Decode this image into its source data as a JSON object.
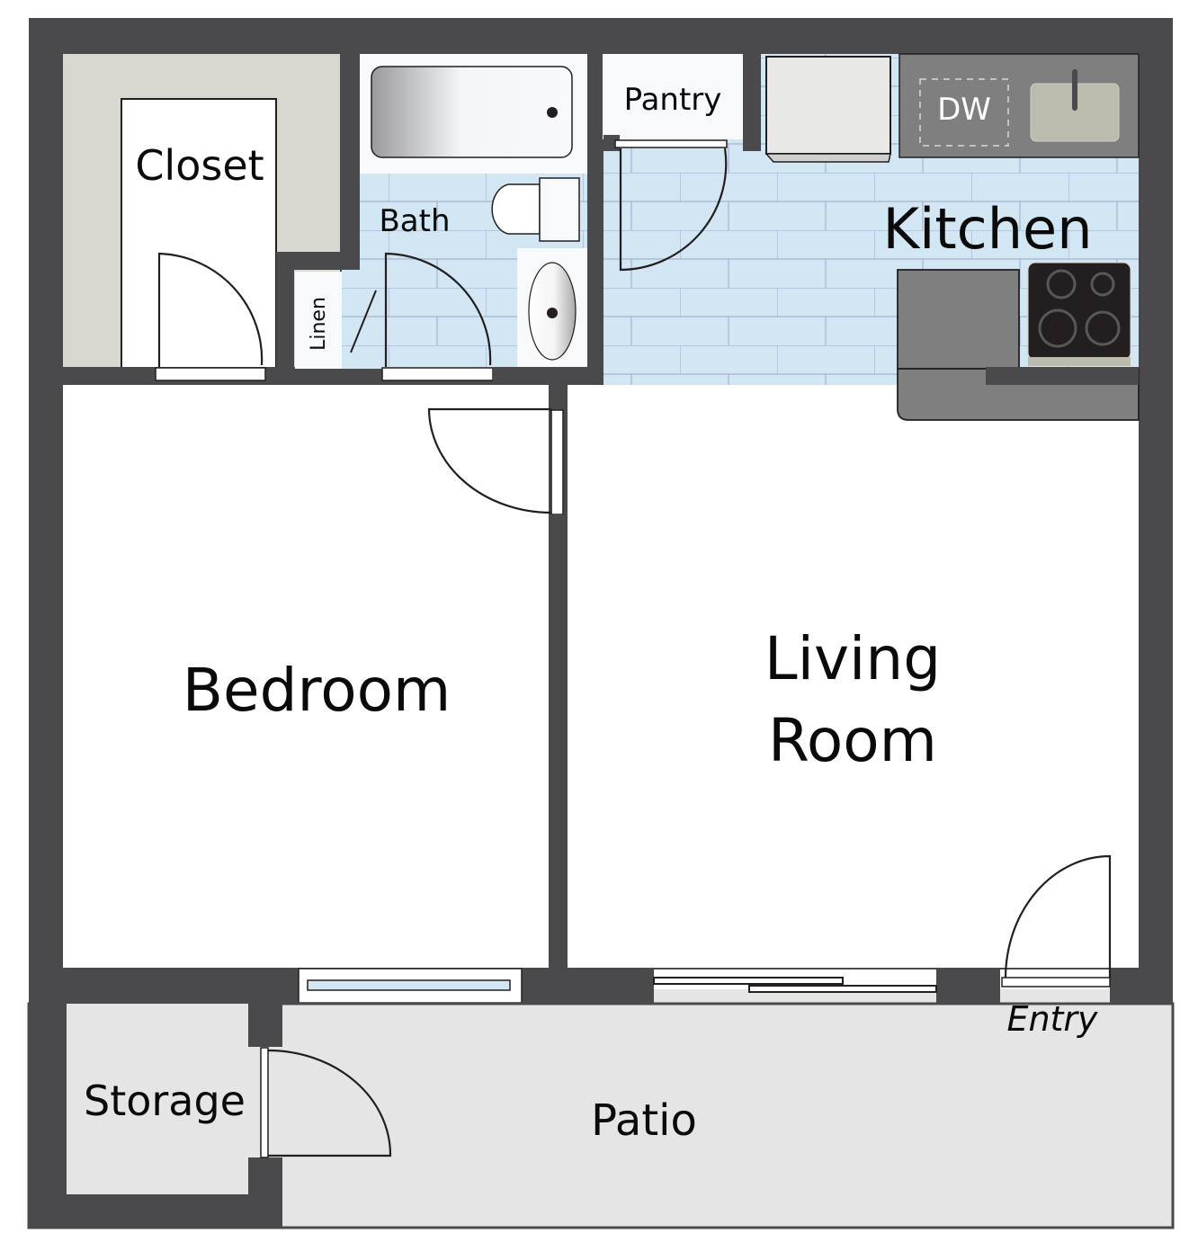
{
  "plan": {
    "rooms": {
      "closet": "Closet",
      "bath": "Bath",
      "linen": "Linen",
      "pantry": "Pantry",
      "kitchen": "Kitchen",
      "bedroom": "Bedroom",
      "living_line1": "Living",
      "living_line2": "Room",
      "storage": "Storage",
      "patio": "Patio",
      "entry": "Entry"
    },
    "appliances": {
      "dishwasher": "DW"
    },
    "colors": {
      "wall": "#4a4a4c",
      "tile_floor": "#d2e6f4",
      "tile_grout": "#9aa8c8",
      "closet_shelf": "#d8d8d0",
      "patio_floor": "#e4e5e4",
      "counter": "#7f7f7f",
      "cooktop": "#231f20",
      "sink": "#bcbcae"
    }
  }
}
